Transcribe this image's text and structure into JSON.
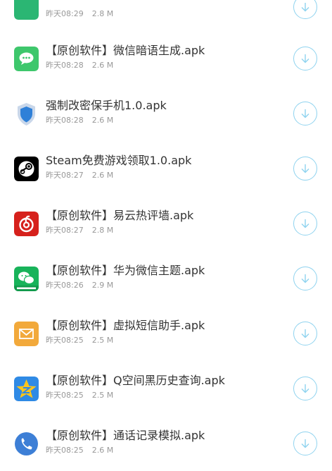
{
  "files": [
    {
      "name": "",
      "time": "昨天08:29",
      "size": "2.8 M",
      "icon": "green-app-icon"
    },
    {
      "name": "【原创软件】微信暗语生成.apk",
      "time": "昨天08:28",
      "size": "2.6 M",
      "icon": "chat-bubble-icon"
    },
    {
      "name": "强制改密保手机1.0.apk",
      "time": "昨天08:28",
      "size": "2.6 M",
      "icon": "shield-icon"
    },
    {
      "name": "Steam免费游戏领取1.0.apk",
      "time": "昨天08:27",
      "size": "2.6 M",
      "icon": "steam-icon"
    },
    {
      "name": "【原创软件】易云热评墙.apk",
      "time": "昨天08:27",
      "size": "2.8 M",
      "icon": "netease-music-icon"
    },
    {
      "name": "【原创软件】华为微信主题.apk",
      "time": "昨天08:26",
      "size": "2.9 M",
      "icon": "huawei-wechat-icon"
    },
    {
      "name": "【原创软件】虚拟短信助手.apk",
      "time": "昨天08:25",
      "size": "2.5 M",
      "icon": "mail-icon"
    },
    {
      "name": "【原创软件】Q空间黑历史查询.apk",
      "time": "昨天08:25",
      "size": "2.5 M",
      "icon": "qzone-star-icon"
    },
    {
      "name": "【原创软件】通话记录模拟.apk",
      "time": "昨天08:25",
      "size": "2.6 M",
      "icon": "phone-icon"
    }
  ],
  "download_icon": "download-arrow-icon",
  "colors": {
    "title": "#333333",
    "meta": "#999999",
    "download_ring": "#8fd3ef"
  }
}
